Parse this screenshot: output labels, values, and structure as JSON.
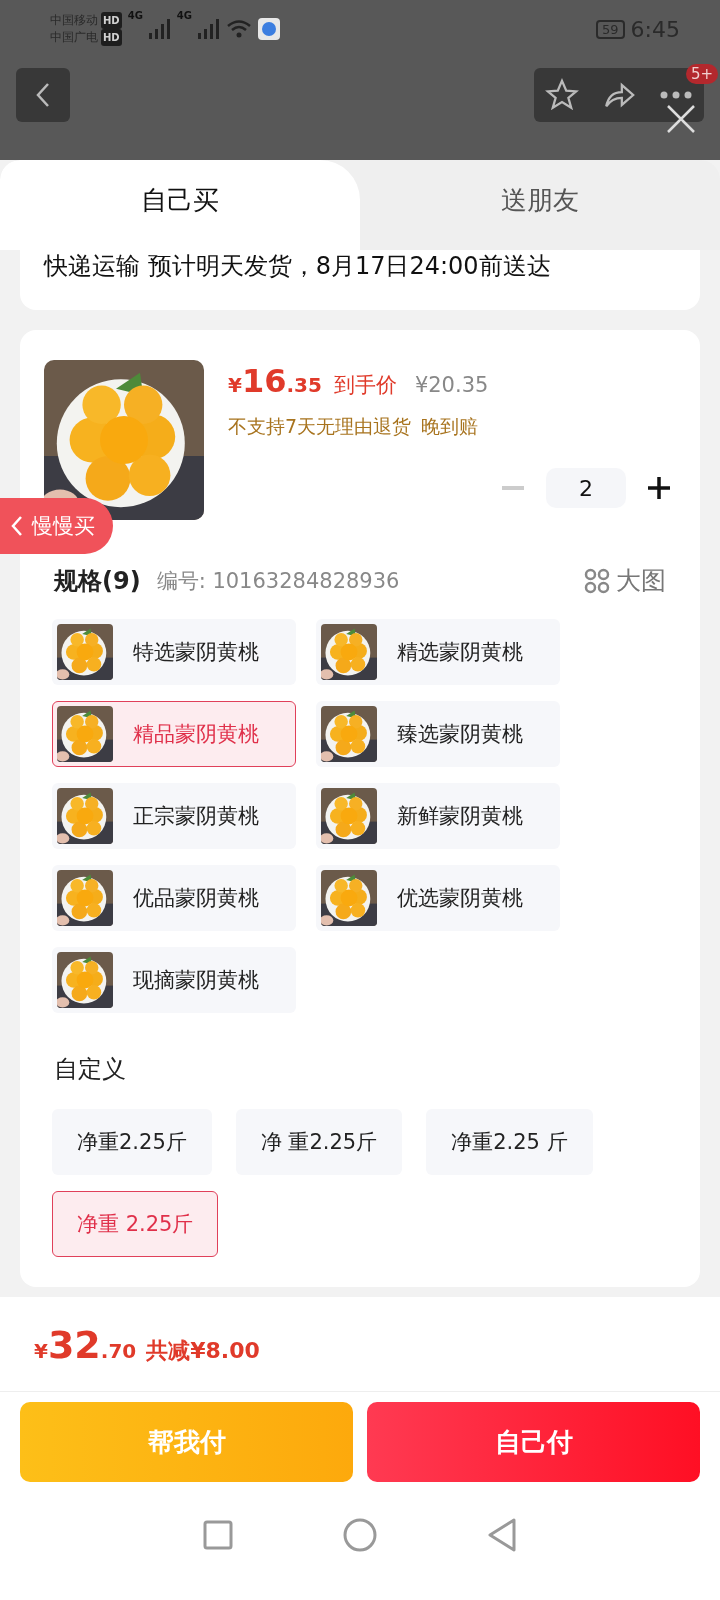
{
  "status_bar": {
    "carriers": [
      {
        "name": "中国移动",
        "badge": "HD"
      },
      {
        "name": "中国广电",
        "badge": "HD"
      }
    ],
    "network": [
      "4G",
      "4G"
    ],
    "battery": "59",
    "time": "6:45"
  },
  "header": {
    "menu_badge": "5+"
  },
  "tabs": [
    {
      "label": "自己买",
      "selected": true
    },
    {
      "label": "送朋友",
      "selected": false
    }
  ],
  "delivery": "快递运输 预计明天发货，8月17日24:00前送达",
  "product": {
    "price_symbol": "¥",
    "price_int": "16",
    "price_dec": ".35",
    "price_label": "到手价",
    "original_price": "¥20.35",
    "notes": [
      "不支持7天无理由退货",
      "晚到赔"
    ],
    "quantity": "2"
  },
  "float_button": {
    "label": "慢慢买"
  },
  "specs": {
    "title": "规格(9)",
    "code": "编号: 10163284828936",
    "big_image": "大图",
    "items": [
      {
        "label": "特选蒙阴黄桃",
        "selected": false
      },
      {
        "label": "精选蒙阴黄桃",
        "selected": false
      },
      {
        "label": "精品蒙阴黄桃",
        "selected": true
      },
      {
        "label": "臻选蒙阴黄桃",
        "selected": false
      },
      {
        "label": "正宗蒙阴黄桃",
        "selected": false
      },
      {
        "label": "新鲜蒙阴黄桃",
        "selected": false
      },
      {
        "label": "优品蒙阴黄桃",
        "selected": false
      },
      {
        "label": "优选蒙阴黄桃",
        "selected": false
      },
      {
        "label": "现摘蒙阴黄桃",
        "selected": false
      }
    ]
  },
  "custom": {
    "title": "自定义",
    "items": [
      {
        "label": "净重2.25斤",
        "selected": false
      },
      {
        "label": "净 重2.25斤",
        "selected": false
      },
      {
        "label": "净重2.25 斤",
        "selected": false
      },
      {
        "label": "净重 2.25斤",
        "selected": true
      }
    ]
  },
  "footer": {
    "price_symbol": "¥",
    "price_int": "32",
    "price_dec": ".70",
    "discount": "共减¥8.00"
  },
  "buttons": [
    {
      "label": "帮我付",
      "kind": "secondary"
    },
    {
      "label": "自己付",
      "kind": "primary"
    }
  ]
}
